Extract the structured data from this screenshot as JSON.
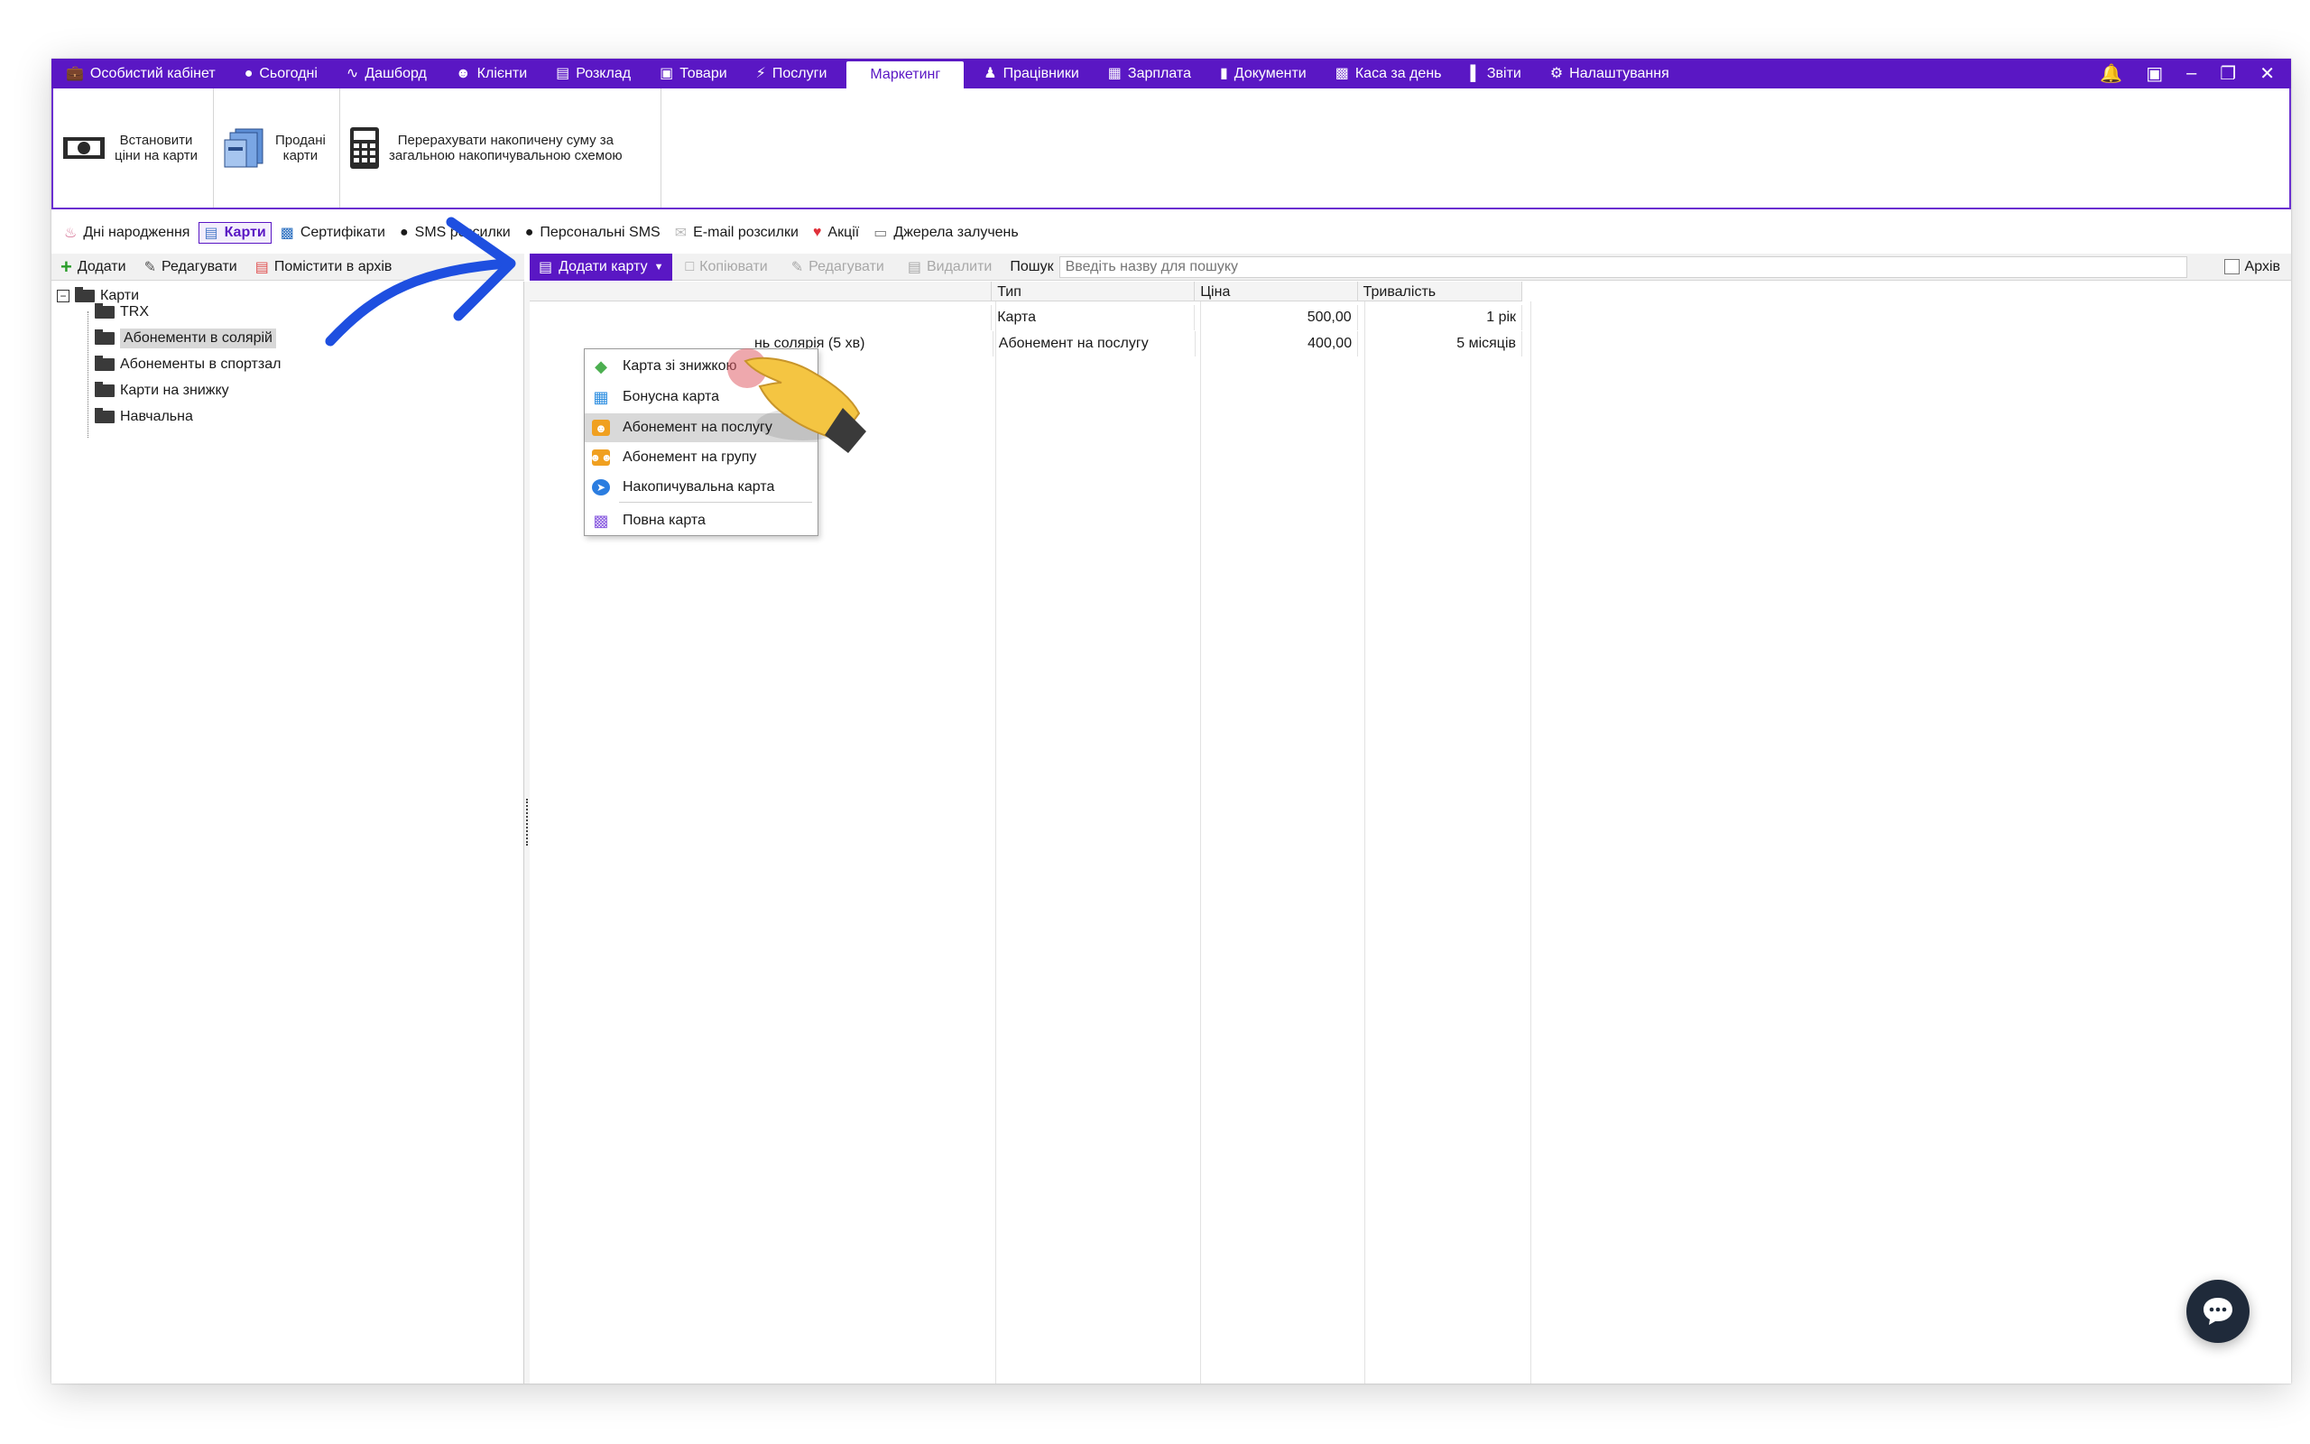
{
  "topbar": {
    "tabs": [
      {
        "label": "Особистий кабінет",
        "icon": "briefcase-icon"
      },
      {
        "label": "Сьогодні",
        "icon": "clock-icon"
      },
      {
        "label": "Дашборд",
        "icon": "pulse-icon"
      },
      {
        "label": "Клієнти",
        "icon": "user-circle-icon"
      },
      {
        "label": "Розклад",
        "icon": "calendar-icon"
      },
      {
        "label": "Товари",
        "icon": "box-icon"
      },
      {
        "label": "Послуги",
        "icon": "bolt-icon"
      },
      {
        "label": "Маркетинг",
        "icon": ""
      },
      {
        "label": "Працівники",
        "icon": "person-icon"
      },
      {
        "label": "Зарплата",
        "icon": "money-icon"
      },
      {
        "label": "Документи",
        "icon": "document-icon"
      },
      {
        "label": "Каса за день",
        "icon": "calculator-icon"
      },
      {
        "label": "Звіти",
        "icon": "bar-chart-icon"
      },
      {
        "label": "Налаштування",
        "icon": "gear-icon"
      }
    ],
    "active_tab": "Маркетинг"
  },
  "ribbon": {
    "set_prices": "Встановити\nціни на карти",
    "sold_cards": "Продані\nкарти",
    "recalculate": "Перерахувати накопичену суму за\nзагальною накопичувальною схемою"
  },
  "subtabs": [
    {
      "label": "Дні народження",
      "icon": "cake-icon"
    },
    {
      "label": "Карти",
      "icon": "card-icon"
    },
    {
      "label": "Сертифікати",
      "icon": "certificate-icon"
    },
    {
      "label": "SMS розсилки",
      "icon": "chat-bubble-icon"
    },
    {
      "label": "Персональні SMS",
      "icon": "chat-bubble-icon"
    },
    {
      "label": "E-mail розсилки",
      "icon": "mail-icon"
    },
    {
      "label": "Акції",
      "icon": "heart-icon"
    },
    {
      "label": "Джерела залучень",
      "icon": "source-icon"
    }
  ],
  "left_toolbar": {
    "add": "Додати",
    "edit": "Редагувати",
    "archive": "Помістити в архів"
  },
  "right_toolbar": {
    "add_card": "Додати карту",
    "copy": "Копіювати",
    "edit": "Редагувати",
    "delete": "Видалити",
    "search_label": "Пошук",
    "search_placeholder": "Введіть назву для пошуку",
    "archive_label": "Архів"
  },
  "tree": {
    "root": "Карти",
    "items": [
      "TRX",
      "Абонементи в солярій",
      "Абонементы в спортзал",
      "Карти на знижку",
      "Навчальна"
    ],
    "selected": "Абонементи в солярій"
  },
  "grid": {
    "headers": [
      "",
      "Тип",
      "Ціна",
      "Тривалість"
    ],
    "rows": [
      {
        "name": "",
        "type": "Карта",
        "price": "500,00",
        "duration": "1 рік"
      },
      {
        "name": "нь солярія (5 хв)",
        "type": "Абонемент на послугу",
        "price": "400,00",
        "duration": "5 місяців"
      }
    ]
  },
  "dropdown": {
    "items": [
      {
        "label": "Карта зі знижкою",
        "icon": "tag-icon",
        "color": "#4caf50"
      },
      {
        "label": "Бонусна карта",
        "icon": "gift-icon",
        "color": "#2b8de0"
      },
      {
        "label": "Абонемент на послугу",
        "icon": "person-card-icon",
        "color": "#f0a020"
      },
      {
        "label": "Абонемент на групу",
        "icon": "group-card-icon",
        "color": "#f0a020"
      },
      {
        "label": "Накопичувальна карта",
        "icon": "compass-icon",
        "color": "#2b7de0"
      },
      {
        "label": "Повна карта",
        "icon": "cards-icon",
        "color": "#8a5ce0"
      }
    ],
    "highlighted": "Абонемент на послугу"
  },
  "colors": {
    "accent": "#5a17c4",
    "arrow": "#1e4fe0"
  }
}
